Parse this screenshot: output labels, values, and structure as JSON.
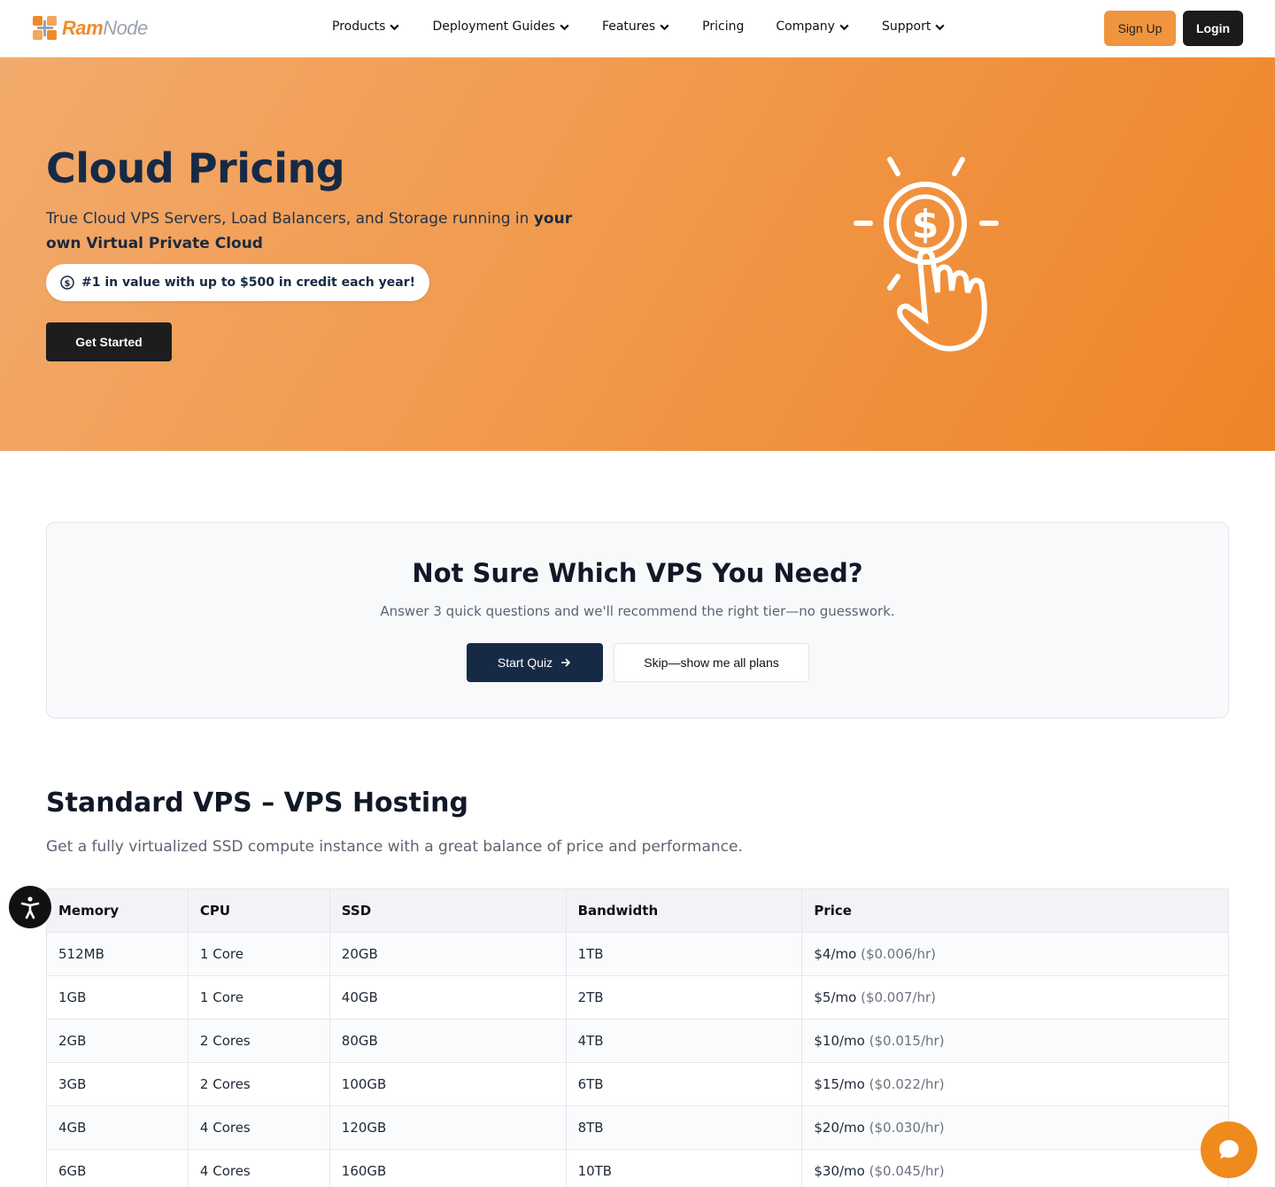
{
  "brand": {
    "name_part1": "Ram",
    "name_part2": "Node",
    "accent": "#ef8a2b"
  },
  "nav": [
    {
      "label": "Products",
      "has_dropdown": true
    },
    {
      "label": "Deployment Guides",
      "has_dropdown": true
    },
    {
      "label": "Features",
      "has_dropdown": true
    },
    {
      "label": "Pricing",
      "has_dropdown": false
    },
    {
      "label": "Company",
      "has_dropdown": true
    },
    {
      "label": "Support",
      "has_dropdown": true
    }
  ],
  "header": {
    "signup_label": "Sign Up",
    "login_label": "Login"
  },
  "hero": {
    "title": "Cloud Pricing",
    "subtitle_plain": "True Cloud VPS Servers, Load Balancers, and Storage running in ",
    "subtitle_bold": "your own Virtual Private Cloud",
    "badge_text": "#1 in value with up to $500 in credit each year!",
    "badge_icon": "dollar-coin-icon",
    "cta_label": "Get Started",
    "illustration": "hand-pointing-dollar-icon"
  },
  "quiz": {
    "title": "Not Sure Which VPS You Need?",
    "subtitle": "Answer 3 quick questions and we'll recommend the right tier—no guesswork.",
    "start_label": "Start Quiz",
    "skip_label": "Skip—show me all plans"
  },
  "plans": {
    "title": "Standard VPS – VPS Hosting",
    "subtitle": "Get a fully virtualized SSD compute instance with a great balance of price and performance.",
    "columns": [
      "Memory",
      "CPU",
      "SSD",
      "Bandwidth",
      "Price"
    ],
    "rows": [
      {
        "memory": "512MB",
        "cpu": "1 Core",
        "ssd": "20GB",
        "bandwidth": "1TB",
        "price": "$4/mo",
        "hourly": "($0.006/hr)"
      },
      {
        "memory": "1GB",
        "cpu": "1 Core",
        "ssd": "40GB",
        "bandwidth": "2TB",
        "price": "$5/mo",
        "hourly": "($0.007/hr)"
      },
      {
        "memory": "2GB",
        "cpu": "2 Cores",
        "ssd": "80GB",
        "bandwidth": "4TB",
        "price": "$10/mo",
        "hourly": "($0.015/hr)"
      },
      {
        "memory": "3GB",
        "cpu": "2 Cores",
        "ssd": "100GB",
        "bandwidth": "6TB",
        "price": "$15/mo",
        "hourly": "($0.022/hr)"
      },
      {
        "memory": "4GB",
        "cpu": "4 Cores",
        "ssd": "120GB",
        "bandwidth": "8TB",
        "price": "$20/mo",
        "hourly": "($0.030/hr)"
      },
      {
        "memory": "6GB",
        "cpu": "4 Cores",
        "ssd": "160GB",
        "bandwidth": "10TB",
        "price": "$30/mo",
        "hourly": "($0.045/hr)"
      }
    ]
  },
  "widgets": {
    "accessibility_icon": "accessibility-icon",
    "chat_icon": "chat-bubble-icon"
  }
}
